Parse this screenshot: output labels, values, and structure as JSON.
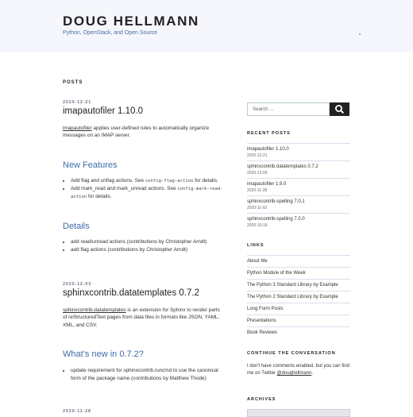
{
  "site": {
    "title": "DOUG HELLMANN",
    "description": "Python, OpenStack, and Open Source"
  },
  "main": {
    "heading": "POSTS",
    "posts": [
      {
        "date": "2020-12-21",
        "title": "imapautofiler 1.10.0",
        "intro_link": "imapautofiler",
        "intro_rest_1": " applies user-defined rules to automatically organize",
        "intro_rest_2": "messages on an IMAP server.",
        "section1": "New Features",
        "features": [
          {
            "a": "Add flag and unflag actions. See ",
            "code": "config-flag-action",
            "b": " for details."
          },
          {
            "a": "Add mark_read and mark_unread actions. See ",
            "code": "config-mark-read-",
            "b": ""
          },
          {
            "a": "",
            "code": "action",
            "b": " for details."
          }
        ],
        "section2": "Details",
        "details": [
          "add read/unread actions (contributions by Christopher Arndt)",
          "add flag actions (contributions by Christopher Arndt)"
        ]
      },
      {
        "date": "2020-12-03",
        "title": "sphinxcontrib.datatemplates 0.7.2",
        "intro_link": "sphinxcontrib.datatemplates",
        "intro_rest_1": " is an extension for Sphinx to render parts",
        "intro_rest_2": "of reStructuredText pages from data files in formats like JSON, YAML,",
        "intro_rest_3": "XML, and CSV.",
        "section1": "What’s new in 0.7.2?",
        "items": [
          "update requirement for sphinxcontrib.runcmd to use the canonical",
          "form of the package name (contributions by Matthew Thode)"
        ]
      },
      {
        "date": "2020-11-28"
      }
    ]
  },
  "sidebar": {
    "search_placeholder": "Search ...",
    "recent_title": "RECENT POSTS",
    "recent": [
      {
        "title": "imapautofiler 1.10.0",
        "date": "2020-12-21"
      },
      {
        "title": "sphinxcontrib.datatemplates 0.7.2",
        "date": "2020-12-03"
      },
      {
        "title": "imapautofiler 1.9.0",
        "date": "2020-11-28"
      },
      {
        "title": "sphinxcontrib-spelling 7.0.1",
        "date": "2020-11-02"
      },
      {
        "title": "sphinxcontrib-spelling 7.0.0",
        "date": "2020-10-19"
      }
    ],
    "links_title": "LINKS",
    "links": [
      "About Me",
      "Python Module of the Week",
      "The Python 3 Standard Library by Example",
      "The Python 2 Standard Library by Example",
      "Long Form Posts",
      "Presentations",
      "Book Reviews"
    ],
    "conv_title": "CONTINUE THE CONVERSATION",
    "conv_text_1": "I don't have comments enabled, but you can find",
    "conv_text_2": "me on Twitter ",
    "conv_link": "@doughellmann",
    "conv_end": ".",
    "archives_title": "ARCHIVES"
  },
  "colors": {
    "header_bg": "#f5f7fc",
    "accent": "#3c6ca8",
    "search_button": "#222222"
  },
  "icons": [
    "search-icon"
  ]
}
